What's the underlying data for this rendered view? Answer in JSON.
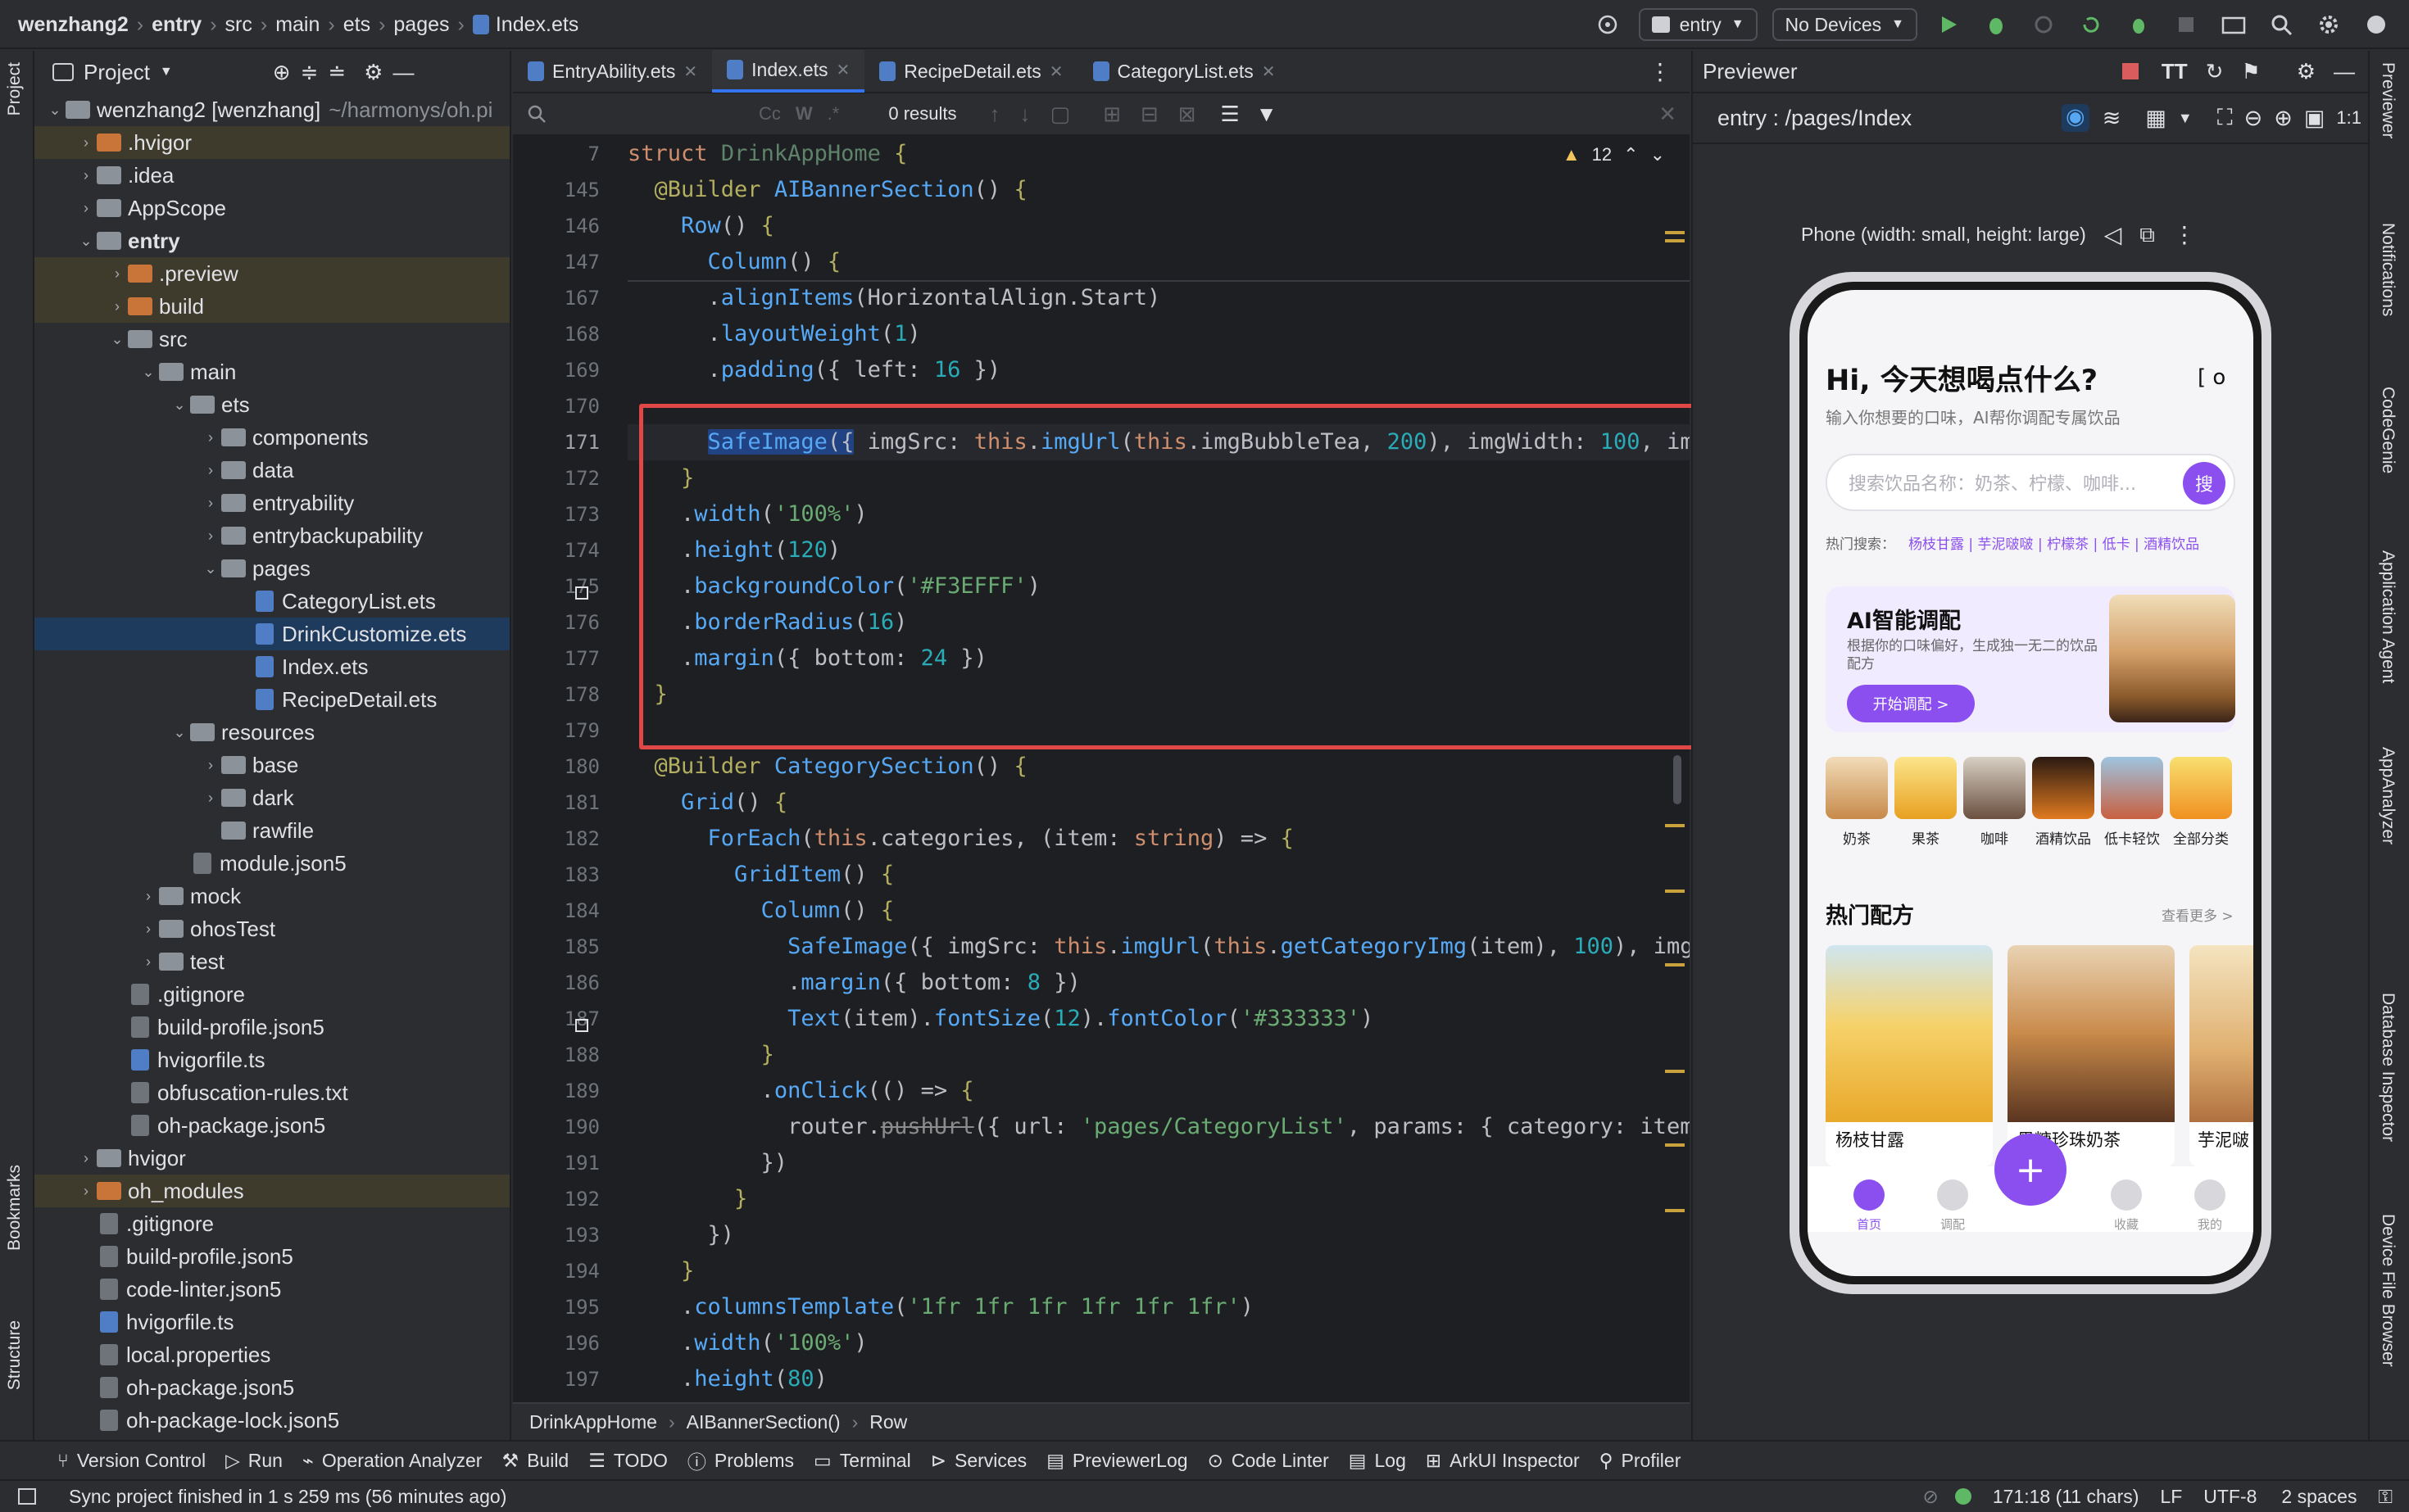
{
  "topbar": {
    "breadcrumbs": [
      "wenzhang2",
      "entry",
      "src",
      "main",
      "ets",
      "pages",
      "Index.ets"
    ],
    "run_config": "entry",
    "device": "No Devices"
  },
  "stripes": {
    "left_top": "Project",
    "left_bottom": [
      "Bookmarks",
      "Structure"
    ],
    "right": [
      "Previewer",
      "Notifications",
      "CodeGenie",
      "Application Agent",
      "AppAnalyzer",
      "Database Inspector",
      "Device File Browser"
    ]
  },
  "project": {
    "title": "Project",
    "root": "wenzhang2 [wenzhang]",
    "root_path": "~/harmonys/oh.pi",
    "tree": [
      {
        "label": ".hvigor",
        "depth": 1,
        "kind": "folder-or",
        "arrow": "right",
        "hl": true
      },
      {
        "label": ".idea",
        "depth": 1,
        "kind": "folder",
        "arrow": "right"
      },
      {
        "label": "AppScope",
        "depth": 1,
        "kind": "folder",
        "arrow": "right"
      },
      {
        "label": "entry",
        "depth": 1,
        "kind": "folder",
        "arrow": "down",
        "bold": true
      },
      {
        "label": ".preview",
        "depth": 2,
        "kind": "folder-or",
        "arrow": "right",
        "hl": true
      },
      {
        "label": "build",
        "depth": 2,
        "kind": "folder-or",
        "arrow": "right",
        "hl": true
      },
      {
        "label": "src",
        "depth": 2,
        "kind": "folder",
        "arrow": "down"
      },
      {
        "label": "main",
        "depth": 3,
        "kind": "folder",
        "arrow": "down"
      },
      {
        "label": "ets",
        "depth": 4,
        "kind": "folder",
        "arrow": "down"
      },
      {
        "label": "components",
        "depth": 5,
        "kind": "folder",
        "arrow": "right"
      },
      {
        "label": "data",
        "depth": 5,
        "kind": "folder",
        "arrow": "right"
      },
      {
        "label": "entryability",
        "depth": 5,
        "kind": "folder",
        "arrow": "right"
      },
      {
        "label": "entrybackupability",
        "depth": 5,
        "kind": "folder",
        "arrow": "right"
      },
      {
        "label": "pages",
        "depth": 5,
        "kind": "folder",
        "arrow": "down"
      },
      {
        "label": "CategoryList.ets",
        "depth": 6,
        "kind": "file"
      },
      {
        "label": "DrinkCustomize.ets",
        "depth": 6,
        "kind": "file",
        "sel": true
      },
      {
        "label": "Index.ets",
        "depth": 6,
        "kind": "file"
      },
      {
        "label": "RecipeDetail.ets",
        "depth": 6,
        "kind": "file"
      },
      {
        "label": "resources",
        "depth": 4,
        "kind": "folder",
        "arrow": "down"
      },
      {
        "label": "base",
        "depth": 5,
        "kind": "folder",
        "arrow": "right"
      },
      {
        "label": "dark",
        "depth": 5,
        "kind": "folder",
        "arrow": "right"
      },
      {
        "label": "rawfile",
        "depth": 5,
        "kind": "folder"
      },
      {
        "label": "module.json5",
        "depth": 4,
        "kind": "json"
      },
      {
        "label": "mock",
        "depth": 3,
        "kind": "folder",
        "arrow": "right"
      },
      {
        "label": "ohosTest",
        "depth": 3,
        "kind": "folder",
        "arrow": "right"
      },
      {
        "label": "test",
        "depth": 3,
        "kind": "folder",
        "arrow": "right"
      },
      {
        "label": ".gitignore",
        "depth": 2,
        "kind": "json"
      },
      {
        "label": "build-profile.json5",
        "depth": 2,
        "kind": "json"
      },
      {
        "label": "hvigorfile.ts",
        "depth": 2,
        "kind": "file"
      },
      {
        "label": "obfuscation-rules.txt",
        "depth": 2,
        "kind": "json"
      },
      {
        "label": "oh-package.json5",
        "depth": 2,
        "kind": "json"
      },
      {
        "label": "hvigor",
        "depth": 1,
        "kind": "folder",
        "arrow": "right"
      },
      {
        "label": "oh_modules",
        "depth": 1,
        "kind": "folder-or",
        "arrow": "right",
        "hl": true
      },
      {
        "label": ".gitignore",
        "depth": 1,
        "kind": "json"
      },
      {
        "label": "build-profile.json5",
        "depth": 1,
        "kind": "json"
      },
      {
        "label": "code-linter.json5",
        "depth": 1,
        "kind": "json"
      },
      {
        "label": "hvigorfile.ts",
        "depth": 1,
        "kind": "file"
      },
      {
        "label": "local.properties",
        "depth": 1,
        "kind": "json"
      },
      {
        "label": "oh-package.json5",
        "depth": 1,
        "kind": "json"
      },
      {
        "label": "oh-package-lock.json5",
        "depth": 1,
        "kind": "json"
      }
    ]
  },
  "editor": {
    "tabs": [
      {
        "label": "EntryAbility.ets",
        "active": false
      },
      {
        "label": "Index.ets",
        "active": true
      },
      {
        "label": "RecipeDetail.ets",
        "active": false
      },
      {
        "label": "CategoryList.ets",
        "active": false
      }
    ],
    "find_results": "0 results",
    "warnings": "12",
    "breadcrumb": [
      "DrinkAppHome",
      "AIBannerSection()",
      "Row"
    ],
    "line_numbers": [
      "7",
      "145",
      "146",
      "147",
      "167",
      "168",
      "169",
      "170",
      "171",
      "172",
      "173",
      "174",
      "175",
      "176",
      "177",
      "178",
      "179",
      "180",
      "181",
      "182",
      "183",
      "184",
      "185",
      "186",
      "187",
      "188",
      "189",
      "190",
      "191",
      "192",
      "193",
      "194",
      "195",
      "196",
      "197"
    ],
    "current_line": "171"
  },
  "previewer": {
    "title": "Previewer",
    "route": "entry : /pages/Index",
    "device_label": "Phone (width: small, height: large)",
    "app": {
      "greeting": "Hi, 今天想喝点什么?",
      "scan_glyph": "[ o",
      "subtitle": "输入你想要的口味，AI帮你调配专属饮品",
      "search_placeholder": "搜索饮品名称：奶茶、柠檬、咖啡...",
      "search_btn": "搜",
      "hot_label": "热门搜索：",
      "hot_terms": "杨枝甘露 | 芋泥啵啵 | 柠檬茶 | 低卡 | 酒精饮品",
      "ai_title": "AI智能调配",
      "ai_desc": "根据你的口味偏好，生成独一无二的饮品配方",
      "ai_btn": "开始调配 >",
      "categories": [
        "奶茶",
        "果茶",
        "咖啡",
        "酒精饮品",
        "低卡轻饮",
        "全部分类"
      ],
      "hot_title": "热门配方",
      "see_more": "查看更多 >",
      "recipes": [
        "杨枝甘露",
        "黑糖珍珠奶茶",
        "芋泥啵"
      ],
      "nav": [
        "首页",
        "调配",
        "+",
        "收藏",
        "我的"
      ]
    }
  },
  "bottom_tools": [
    "Version Control",
    "Run",
    "Operation Analyzer",
    "Build",
    "TODO",
    "Problems",
    "Terminal",
    "Services",
    "PreviewerLog",
    "Code Linter",
    "Log",
    "ArkUI Inspector",
    "Profiler"
  ],
  "status": {
    "message": "Sync project finished in 1 s 259 ms (56 minutes ago)",
    "position": "171:18 (11 chars)",
    "line_sep": "LF",
    "encoding": "UTF-8",
    "indent": "2 spaces"
  },
  "colors": {
    "accent": "#3574f0",
    "purple": "#8b4ff0",
    "highlight_box": "#e04848"
  }
}
